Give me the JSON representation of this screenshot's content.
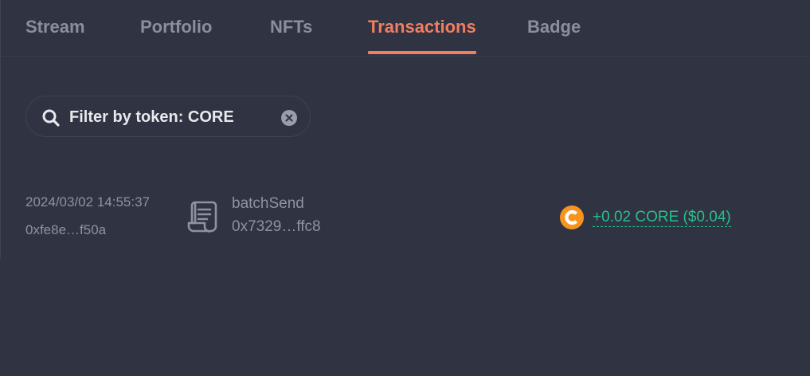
{
  "tabs": [
    {
      "label": "Stream",
      "active": false
    },
    {
      "label": "Portfolio",
      "active": false
    },
    {
      "label": "NFTs",
      "active": false
    },
    {
      "label": "Transactions",
      "active": true
    },
    {
      "label": "Badge",
      "active": false
    }
  ],
  "filter": {
    "text": "Filter by token: CORE",
    "icon": "search-icon",
    "clear_icon": "close-icon"
  },
  "transactions": [
    {
      "timestamp": "2024/03/02 14:55:37",
      "tx_hash": "0xfe8e…f50a",
      "method": "batchSend",
      "contract": "0x7329…ffc8",
      "contract_icon": "contract-scroll-icon",
      "token_icon": "core-token-icon",
      "amount": "+0.02 CORE ($0.04)"
    }
  ],
  "colors": {
    "background": "#2f3342",
    "accent": "#f37d60",
    "muted_text": "#8e93a0",
    "positive": "#28c08a",
    "token_orange": "#f79420"
  }
}
